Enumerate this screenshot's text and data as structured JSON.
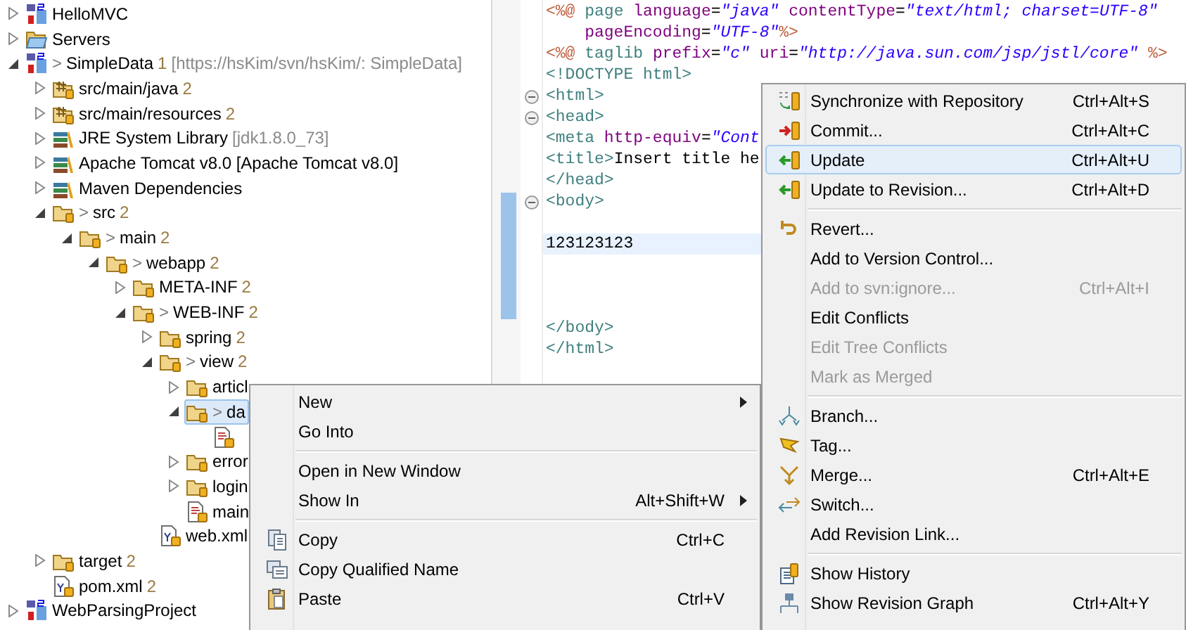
{
  "tree": [
    {
      "name": "HelloMVC",
      "kind": "project",
      "expanded": false,
      "selected": false
    },
    {
      "name": "Servers",
      "kind": "open-folder",
      "expanded": false,
      "selected": false
    },
    {
      "name": "SimpleData",
      "prefix": ">",
      "count": "1",
      "decoration": "[https://hsKim/svn/hsKim/: SimpleData]",
      "kind": "project",
      "expanded": true,
      "selected": false,
      "children": [
        {
          "name": "src/main/java",
          "count": "2",
          "kind": "package",
          "expanded": false,
          "selected": false
        },
        {
          "name": "src/main/resources",
          "count": "2",
          "kind": "package",
          "expanded": false,
          "selected": false
        },
        {
          "name": "JRE System Library",
          "decoration": "[jdk1.8.0_73]",
          "kind": "library",
          "expanded": false,
          "selected": false
        },
        {
          "name": "Apache Tomcat v8.0 [Apache Tomcat v8.0]",
          "kind": "library",
          "expanded": false,
          "selected": false
        },
        {
          "name": "Maven Dependencies",
          "kind": "library",
          "expanded": false,
          "selected": false
        },
        {
          "name": "src",
          "prefix": ">",
          "count": "2",
          "kind": "folder",
          "expanded": true,
          "selected": false,
          "children": [
            {
              "name": "main",
              "prefix": ">",
              "count": "2",
              "kind": "folder",
              "expanded": true,
              "selected": false,
              "children": [
                {
                  "name": "webapp",
                  "prefix": ">",
                  "count": "2",
                  "kind": "folder",
                  "expanded": true,
                  "selected": false,
                  "children": [
                    {
                      "name": "META-INF",
                      "count": "2",
                      "kind": "folder",
                      "expanded": false,
                      "selected": false
                    },
                    {
                      "name": "WEB-INF",
                      "prefix": ">",
                      "count": "2",
                      "kind": "folder",
                      "expanded": true,
                      "selected": false,
                      "children": [
                        {
                          "name": "spring",
                          "count": "2",
                          "kind": "folder",
                          "expanded": false,
                          "selected": false
                        },
                        {
                          "name": "view",
                          "prefix": ">",
                          "count": "2",
                          "kind": "folder",
                          "expanded": true,
                          "selected": false,
                          "children": [
                            {
                              "name": "articl",
                              "kind": "folder",
                              "expanded": false,
                              "selected": false
                            },
                            {
                              "name": "da",
                              "prefix": ">",
                              "kind": "folder",
                              "expanded": true,
                              "selected": true,
                              "children": [
                                {
                                  "kind": "file",
                                  "selected": false
                                }
                              ]
                            },
                            {
                              "name": "error",
                              "kind": "folder",
                              "expanded": false,
                              "selected": false
                            },
                            {
                              "name": "login",
                              "kind": "folder",
                              "expanded": false,
                              "selected": false
                            },
                            {
                              "name": "main",
                              "kind": "file",
                              "selected": false
                            }
                          ]
                        },
                        {
                          "name": "web.xml",
                          "kind": "xml",
                          "selected": false
                        }
                      ]
                    }
                  ]
                }
              ]
            }
          ]
        },
        {
          "name": "target",
          "count": "2",
          "kind": "folder",
          "expanded": false,
          "selected": false
        },
        {
          "name": "pom.xml",
          "count": "2",
          "kind": "xml",
          "selected": false
        }
      ]
    },
    {
      "name": "WebParsingProject",
      "kind": "project",
      "expanded": false,
      "selected": false
    }
  ],
  "editor": {
    "lines": [
      {
        "fold": false,
        "current": false,
        "tokens": [
          {
            "kind": "delim",
            "text": "<%@"
          },
          {
            "kind": "tag",
            "text": " page "
          },
          {
            "kind": "attr",
            "text": "language"
          },
          {
            "kind": "plain",
            "text": "="
          },
          {
            "kind": "value",
            "text": "\"java\""
          },
          {
            "kind": "attr",
            "text": " contentType"
          },
          {
            "kind": "plain",
            "text": "="
          },
          {
            "kind": "value",
            "text": "\"text/html; charset=UTF-8\""
          }
        ]
      },
      {
        "fold": false,
        "current": false,
        "tokens": [
          {
            "kind": "attr",
            "text": "    pageEncoding"
          },
          {
            "kind": "plain",
            "text": "="
          },
          {
            "kind": "value",
            "text": "\"UTF-8\""
          },
          {
            "kind": "delim",
            "text": "%>"
          }
        ]
      },
      {
        "fold": false,
        "current": false,
        "tokens": [
          {
            "kind": "delim",
            "text": "<%@"
          },
          {
            "kind": "tag",
            "text": " taglib "
          },
          {
            "kind": "attr",
            "text": "prefix"
          },
          {
            "kind": "plain",
            "text": "="
          },
          {
            "kind": "value",
            "text": "\"c\""
          },
          {
            "kind": "attr",
            "text": " uri"
          },
          {
            "kind": "plain",
            "text": "="
          },
          {
            "kind": "value",
            "text": "\"http://java.sun.com/jsp/jstl/core\""
          },
          {
            "kind": "delim",
            "text": " %>"
          }
        ]
      },
      {
        "fold": false,
        "current": false,
        "tokens": [
          {
            "kind": "tag",
            "text": "<!DOCTYPE html>"
          }
        ]
      },
      {
        "fold": true,
        "current": false,
        "tokens": [
          {
            "kind": "tag",
            "text": "<html>"
          }
        ]
      },
      {
        "fold": true,
        "current": false,
        "tokens": [
          {
            "kind": "tag",
            "text": "<head>"
          }
        ]
      },
      {
        "fold": false,
        "current": false,
        "tokens": [
          {
            "kind": "tag",
            "text": "<meta "
          },
          {
            "kind": "attr",
            "text": "http-equiv"
          },
          {
            "kind": "plain",
            "text": "="
          },
          {
            "kind": "value",
            "text": "\"Cont"
          }
        ]
      },
      {
        "fold": false,
        "current": false,
        "tokens": [
          {
            "kind": "tag",
            "text": "<title>"
          },
          {
            "kind": "plain",
            "text": "Insert title he"
          }
        ]
      },
      {
        "fold": false,
        "current": false,
        "tokens": [
          {
            "kind": "tag",
            "text": "</head>"
          }
        ]
      },
      {
        "fold": true,
        "current": false,
        "tokens": [
          {
            "kind": "tag",
            "text": "<body>"
          }
        ]
      },
      {
        "fold": false,
        "current": false
      },
      {
        "fold": false,
        "current": true,
        "tokens": [
          {
            "kind": "plain",
            "text": "123123123"
          }
        ]
      },
      {
        "fold": false,
        "current": false
      },
      {
        "fold": false,
        "current": false
      },
      {
        "fold": false,
        "current": false
      },
      {
        "fold": false,
        "current": false,
        "tokens": [
          {
            "kind": "tag",
            "text": "</body>"
          }
        ]
      },
      {
        "fold": false,
        "current": false,
        "tokens": [
          {
            "kind": "tag",
            "text": "</html>"
          }
        ]
      }
    ]
  },
  "context_menu": [
    {
      "kind": "plain",
      "label": "New",
      "submenu": true,
      "disabled": false,
      "selected": false
    },
    {
      "kind": "plain",
      "label": "Go Into",
      "submenu": false,
      "disabled": false,
      "selected": false
    },
    {
      "kind": "separator"
    },
    {
      "kind": "plain",
      "label": "Open in New Window",
      "submenu": false,
      "disabled": false,
      "selected": false
    },
    {
      "kind": "plain",
      "label": "Show In",
      "shortcut": "Alt+Shift+W",
      "submenu": true,
      "disabled": false,
      "selected": false
    },
    {
      "kind": "separator"
    },
    {
      "kind": "copy",
      "label": "Copy",
      "shortcut": "Ctrl+C",
      "submenu": false,
      "disabled": false,
      "selected": false
    },
    {
      "kind": "copy-name",
      "label": "Copy Qualified Name",
      "submenu": false,
      "disabled": false,
      "selected": false
    },
    {
      "kind": "paste",
      "label": "Paste",
      "shortcut": "Ctrl+V",
      "submenu": false,
      "disabled": false,
      "selected": false
    }
  ],
  "team_menu": [
    {
      "kind": "sync",
      "label": "Synchronize with Repository",
      "shortcut": "Ctrl+Alt+S",
      "disabled": false,
      "selected": false
    },
    {
      "kind": "commit",
      "label": "Commit...",
      "shortcut": "Ctrl+Alt+C",
      "disabled": false,
      "selected": false
    },
    {
      "kind": "update",
      "label": "Update",
      "shortcut": "Ctrl+Alt+U",
      "disabled": false,
      "selected": true
    },
    {
      "kind": "update",
      "label": "Update to Revision...",
      "shortcut": "Ctrl+Alt+D",
      "disabled": false,
      "selected": false
    },
    {
      "kind": "separator"
    },
    {
      "kind": "revert",
      "label": "Revert...",
      "disabled": false,
      "selected": false
    },
    {
      "kind": "plain",
      "label": "Add to Version Control...",
      "disabled": false,
      "selected": false
    },
    {
      "kind": "plain",
      "label": "Add to svn:ignore...",
      "shortcut": "Ctrl+Alt+I",
      "disabled": true,
      "selected": false
    },
    {
      "kind": "plain",
      "label": "Edit Conflicts",
      "disabled": false,
      "selected": false
    },
    {
      "kind": "plain",
      "label": "Edit Tree Conflicts",
      "disabled": true,
      "selected": false
    },
    {
      "kind": "plain",
      "label": "Mark as Merged",
      "disabled": true,
      "selected": false
    },
    {
      "kind": "separator"
    },
    {
      "kind": "branch",
      "label": "Branch...",
      "disabled": false,
      "selected": false
    },
    {
      "kind": "tag",
      "label": "Tag...",
      "disabled": false,
      "selected": false
    },
    {
      "kind": "merge",
      "label": "Merge...",
      "shortcut": "Ctrl+Alt+E",
      "disabled": false,
      "selected": false
    },
    {
      "kind": "switch",
      "label": "Switch...",
      "disabled": false,
      "selected": false
    },
    {
      "kind": "plain",
      "label": "Add Revision Link...",
      "disabled": false,
      "selected": false
    },
    {
      "kind": "separator"
    },
    {
      "kind": "history",
      "label": "Show History",
      "disabled": false,
      "selected": false
    },
    {
      "kind": "graph",
      "label": "Show Revision Graph",
      "shortcut": "Ctrl+Alt+Y",
      "disabled": false,
      "selected": false
    }
  ]
}
